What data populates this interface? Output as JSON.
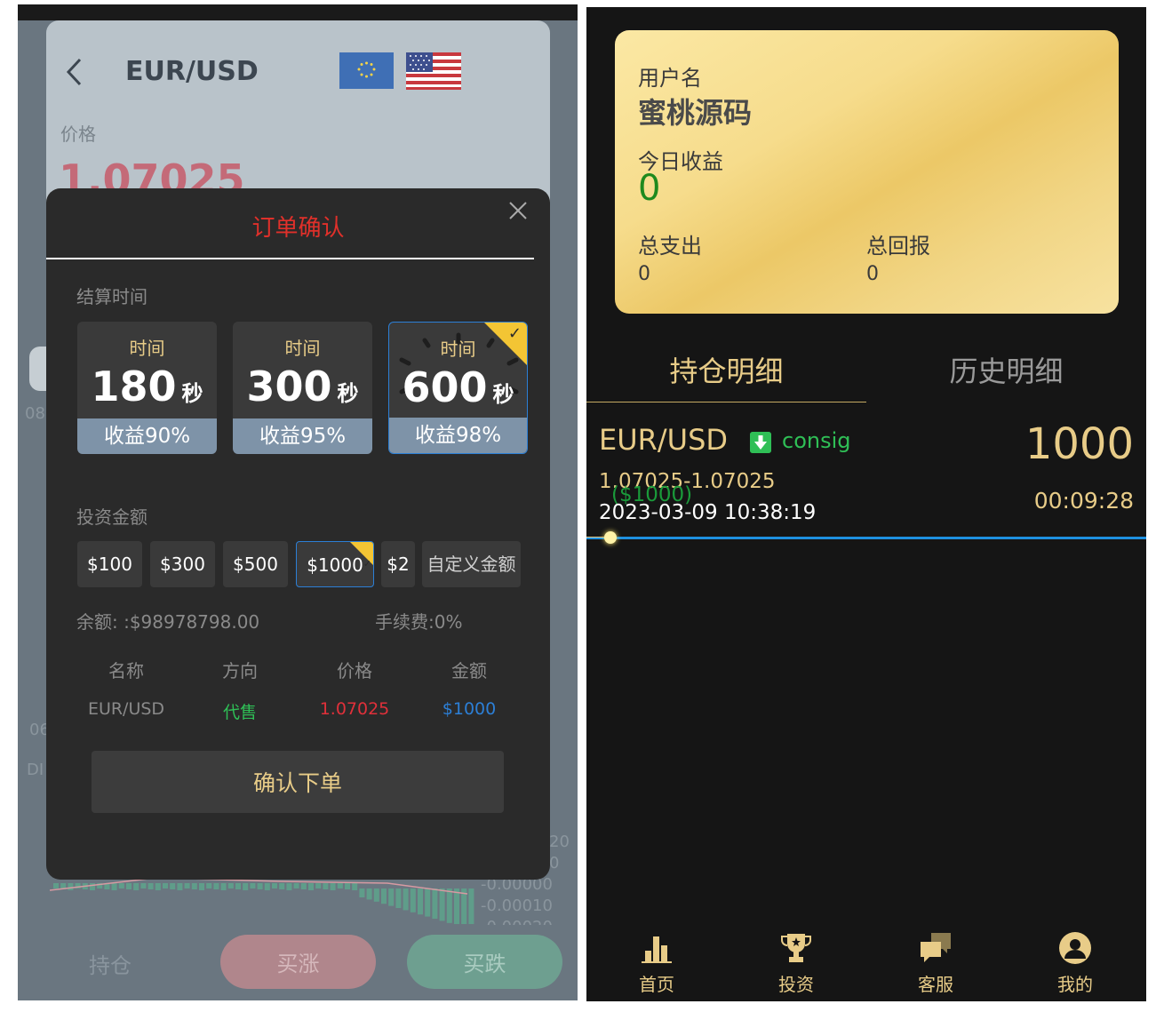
{
  "left": {
    "header": {
      "pair": "EUR/USD",
      "price_label": "价格",
      "price": "1.07025"
    },
    "axis_labels": [
      "08",
      "06",
      "DI"
    ],
    "chart_values": [
      "20",
      "0",
      "-0.00000",
      "-0.00010",
      "-0.00020"
    ],
    "bottom": {
      "hold": "持仓",
      "buy_up": "买涨",
      "buy_down": "买跌"
    },
    "modal": {
      "title": "订单确认",
      "settle_label": "结算时间",
      "times": [
        {
          "label": "时间",
          "seconds": "180",
          "unit": "秒",
          "yield": "收益90%"
        },
        {
          "label": "时间",
          "seconds": "300",
          "unit": "秒",
          "yield": "收益95%"
        },
        {
          "label": "时间",
          "seconds": "600",
          "unit": "秒",
          "yield": "收益98%",
          "selected": true
        }
      ],
      "invest_label": "投资金额",
      "amounts": [
        "$100",
        "$300",
        "$500",
        "$1000",
        "$2",
        "自定义金额"
      ],
      "balance": "余额: :$98978798.00",
      "fee": "手续费:0%",
      "table": {
        "headers": [
          "名称",
          "方向",
          "价格",
          "金额"
        ],
        "row": [
          "EUR/USD",
          "代售",
          "1.07025",
          "$1000"
        ]
      },
      "confirm": "确认下单",
      "colors": {
        "direction": "#2fbf56",
        "price": "#e0303a",
        "amount": "#2c7fd6"
      }
    }
  },
  "right": {
    "card": {
      "username_label": "用户名",
      "username": "蜜桃源码",
      "today_label": "今日收益",
      "today_value": "0",
      "expense_label": "总支出",
      "expense_value": "0",
      "return_label": "总回报",
      "return_value": "0"
    },
    "tabs": [
      "持仓明细",
      "历史明细"
    ],
    "position": {
      "pair": "EUR/USD",
      "direction": "consig",
      "amount": "1000",
      "range": "1.07025-1.07025",
      "pnl": "($1000)",
      "time": "2023-03-09 10:38:19",
      "countdown": "00:09:28",
      "progress": 0.04
    },
    "nav": [
      "首页",
      "投资",
      "客服",
      "我的"
    ],
    "accent": "#e8cc88"
  }
}
